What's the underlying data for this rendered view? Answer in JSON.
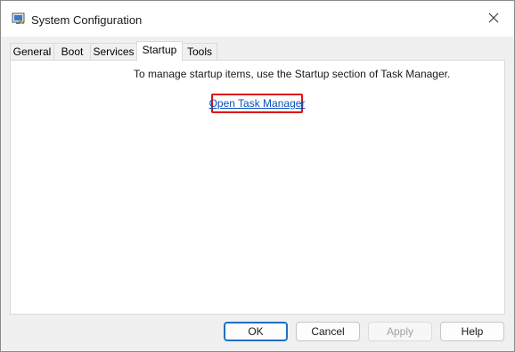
{
  "window": {
    "title": "System Configuration",
    "app_icon": "msconfig-icon",
    "close_icon": "close-icon"
  },
  "tabs": [
    {
      "label": "General",
      "active": false
    },
    {
      "label": "Boot",
      "active": false
    },
    {
      "label": "Services",
      "active": false
    },
    {
      "label": "Startup",
      "active": true
    },
    {
      "label": "Tools",
      "active": false
    }
  ],
  "startup": {
    "message": "To manage startup items, use the Startup section of Task Manager.",
    "link_label": "Open Task Manager",
    "highlight_color": "#e01010"
  },
  "buttons": {
    "ok": "OK",
    "cancel": "Cancel",
    "apply": "Apply",
    "help": "Help"
  },
  "colors": {
    "link": "#0a4fb8",
    "default_button_border": "#1f6fc1"
  }
}
